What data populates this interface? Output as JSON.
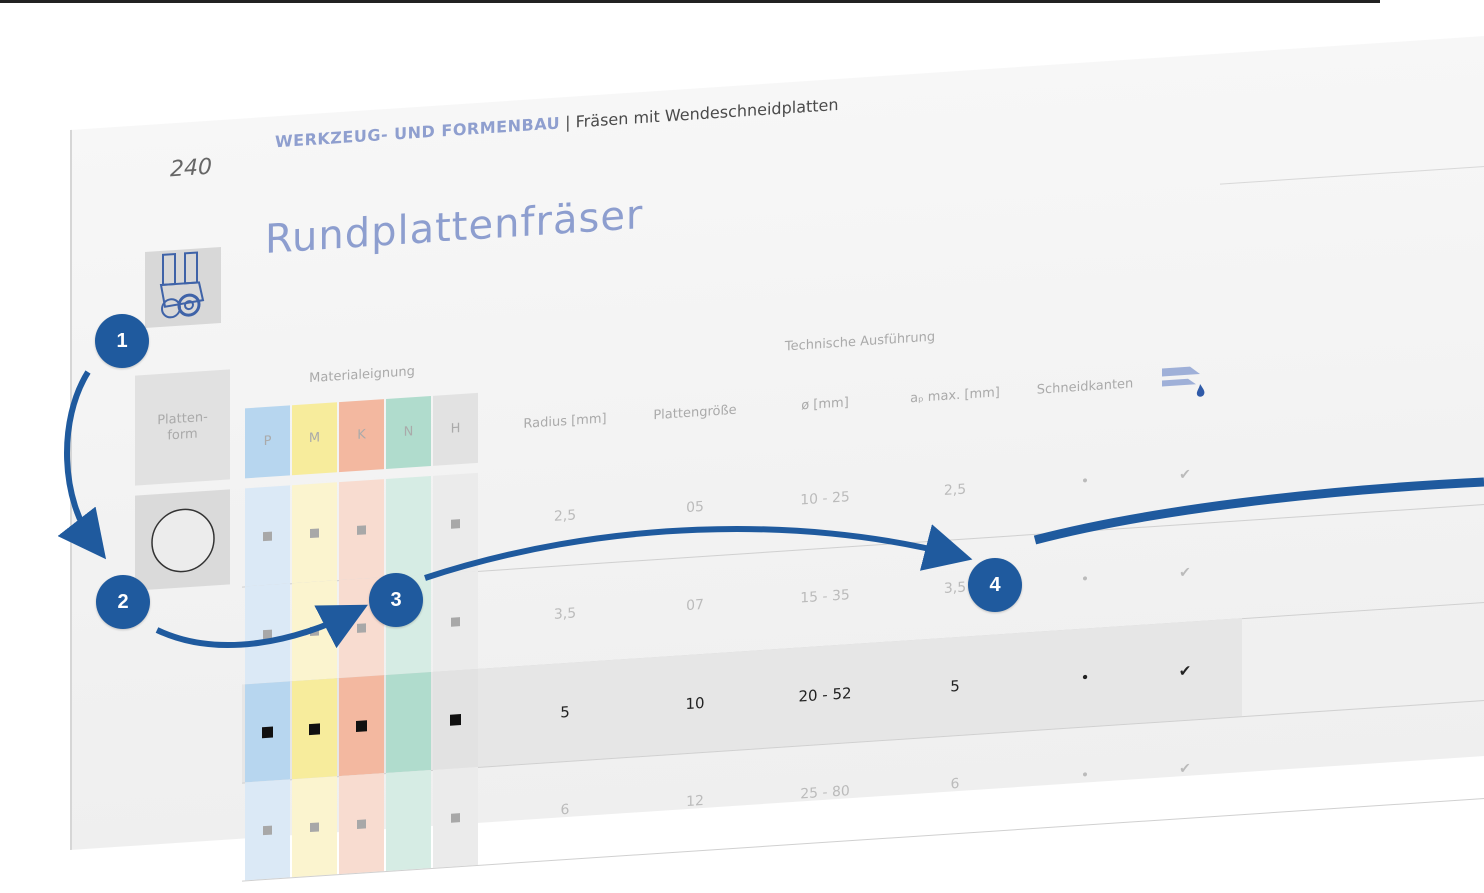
{
  "page": {
    "number": "240",
    "header_strong": "WERKZEUG- UND FORMENBAU",
    "header_rest": " | Fräsen mit Wendeschneidplatten",
    "title": "Rundplattenfräser"
  },
  "table": {
    "plattenform_label": "Platten-\nform",
    "material_label": "Materialeignung",
    "material_cols": [
      "P",
      "M",
      "K",
      "N",
      "H"
    ],
    "tech_label": "Technische Ausführung",
    "tech_cols": [
      "Radius [mm]",
      "Plattengröße",
      "ø [mm]",
      "aₚ max. [mm]",
      "Schneidkanten"
    ],
    "rows": [
      {
        "radius": "2,5",
        "size": "05",
        "diameter": "10 - 25",
        "ap": "2,5",
        "edges": "•",
        "check": "✔"
      },
      {
        "radius": "3,5",
        "size": "07",
        "diameter": "15 - 35",
        "ap": "3,5",
        "edges": "•",
        "check": "✔"
      },
      {
        "radius": "5",
        "size": "10",
        "diameter": "20 - 52",
        "ap": "5",
        "edges": "•",
        "check": "✔"
      },
      {
        "radius": "6",
        "size": "12",
        "diameter": "25 - 80",
        "ap": "6",
        "edges": "•",
        "check": "✔"
      }
    ]
  },
  "callouts": [
    "1",
    "2",
    "3",
    "4"
  ],
  "colors": {
    "accent_blue": "#1f5a9e",
    "title_blue": "#8d9ecf"
  },
  "icons": [
    "tool-holder-icon",
    "coolant-icon",
    "round-insert-icon"
  ]
}
